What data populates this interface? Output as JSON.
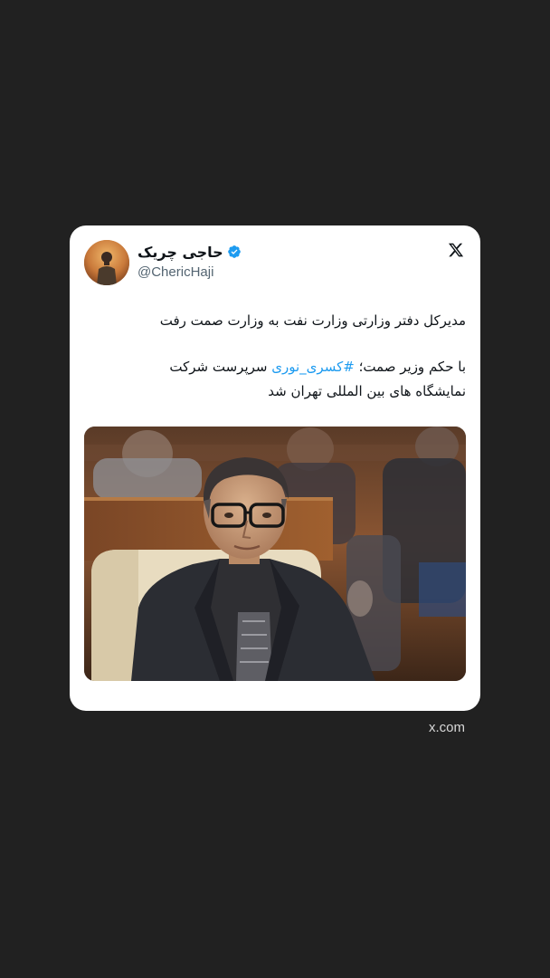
{
  "tweet": {
    "author": {
      "display_name": "حاجی چریک",
      "handle": "@ChericHaji",
      "verified": true,
      "verified_color": "#1d9bf0"
    },
    "text": {
      "line1": "مدیرکل دفتر وزارتی وزارت نفت به وزارت صمت رفت",
      "line2_before": "با حکم وزیر صمت؛ ",
      "hashtag": "#کسری_نوری",
      "line2_after": " سرپرست شرکت",
      "line3": "نمایشگاه های بین المللی تهران شد"
    },
    "media": {
      "description_icon": "photo"
    },
    "platform_icon": "x-logo-icon"
  },
  "source": "x.com",
  "colors": {
    "background": "#212121",
    "card": "#ffffff",
    "link": "#1d9bf0",
    "secondary_text": "#536471"
  }
}
